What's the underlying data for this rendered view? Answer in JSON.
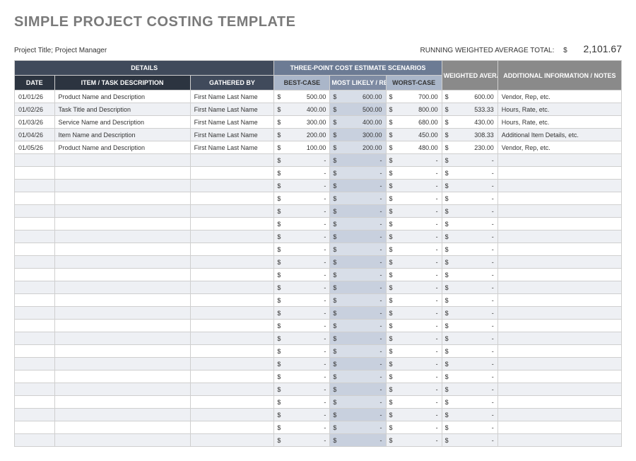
{
  "title": "SIMPLE PROJECT COSTING TEMPLATE",
  "meta": {
    "project_label": "Project Title; Project Manager",
    "running_label": "RUNNING WEIGHTED AVERAGE TOTAL:",
    "currency": "$",
    "total": "2,101.67"
  },
  "headers": {
    "details": "DETAILS",
    "scenarios": "THREE-POINT COST ESTIMATE SCENARIOS",
    "weighted": "WEIGHTED AVERAGE",
    "notes": "ADDITIONAL INFORMATION / NOTES",
    "date": "DATE",
    "item": "ITEM / TASK DESCRIPTION",
    "gathered": "GATHERED BY",
    "best": "BEST-CASE",
    "likely": "MOST LIKELY / REALISTIC",
    "worst": "WORST-CASE"
  },
  "rows": [
    {
      "date": "01/01/26",
      "item": "Product Name and Description",
      "gathered": "First Name Last Name",
      "best": "500.00",
      "likely": "600.00",
      "worst": "700.00",
      "weighted": "600.00",
      "notes": "Vendor, Rep, etc."
    },
    {
      "date": "01/02/26",
      "item": "Task Title and Description",
      "gathered": "First Name Last Name",
      "best": "400.00",
      "likely": "500.00",
      "worst": "800.00",
      "weighted": "533.33",
      "notes": "Hours, Rate, etc."
    },
    {
      "date": "01/03/26",
      "item": "Service Name and Description",
      "gathered": "First Name Last Name",
      "best": "300.00",
      "likely": "400.00",
      "worst": "680.00",
      "weighted": "430.00",
      "notes": "Hours, Rate, etc."
    },
    {
      "date": "01/04/26",
      "item": "Item Name and Description",
      "gathered": "First Name Last Name",
      "best": "200.00",
      "likely": "300.00",
      "worst": "450.00",
      "weighted": "308.33",
      "notes": "Additional Item Details, etc."
    },
    {
      "date": "01/05/26",
      "item": "Product Name and Description",
      "gathered": "First Name Last Name",
      "best": "100.00",
      "likely": "200.00",
      "worst": "480.00",
      "weighted": "230.00",
      "notes": "Vendor, Rep, etc."
    }
  ],
  "empty_row_count": 23,
  "placeholder_dash": "-"
}
